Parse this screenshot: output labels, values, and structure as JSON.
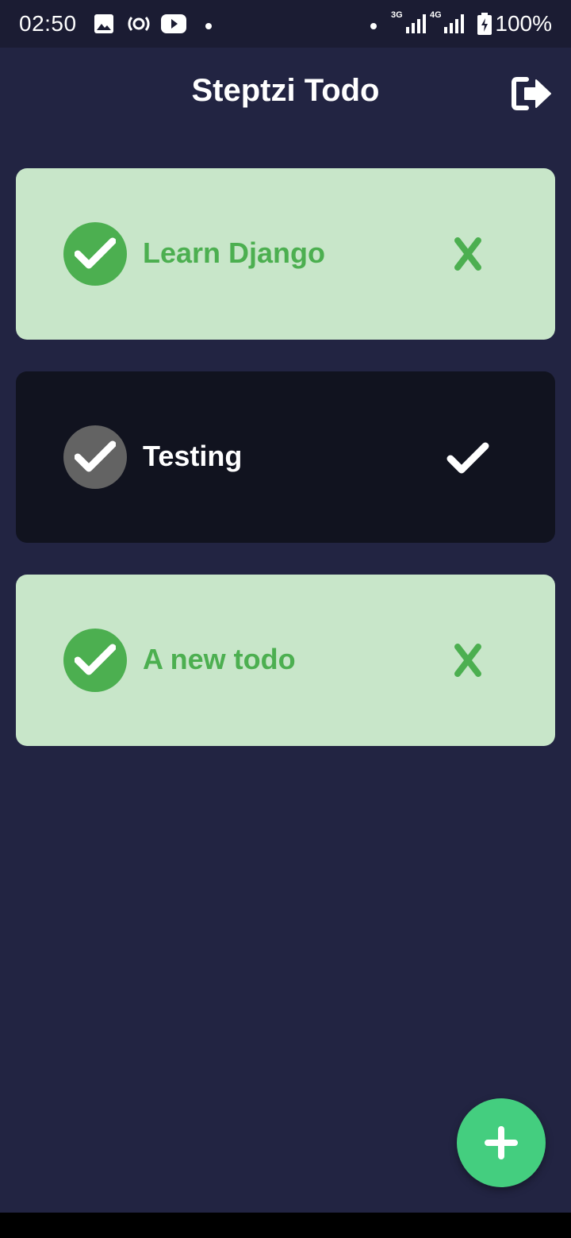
{
  "status_bar": {
    "time": "02:50",
    "battery": "100%",
    "network_3g": "3G",
    "network_4g": "4G",
    "icons": [
      "image-icon",
      "hotspot-icon",
      "youtube-icon",
      "dot-icon",
      "signal-icon",
      "battery-charging-icon"
    ]
  },
  "app_bar": {
    "title": "Steptzi Todo",
    "logout_icon": "logout-icon"
  },
  "todos": [
    {
      "label": "Learn Django",
      "completed": true,
      "action_icon": "close-icon"
    },
    {
      "label": "Testing",
      "completed": false,
      "action_icon": "check-icon"
    },
    {
      "label": "A new todo",
      "completed": true,
      "action_icon": "close-icon"
    }
  ],
  "fab": {
    "icon": "plus-icon"
  },
  "colors": {
    "background": "#222442",
    "status_bar": "#1b1c33",
    "done_card": "#c8e6c9",
    "pending_card": "#11131f",
    "accent_green": "#4caf50",
    "fab": "#44ce7f"
  }
}
